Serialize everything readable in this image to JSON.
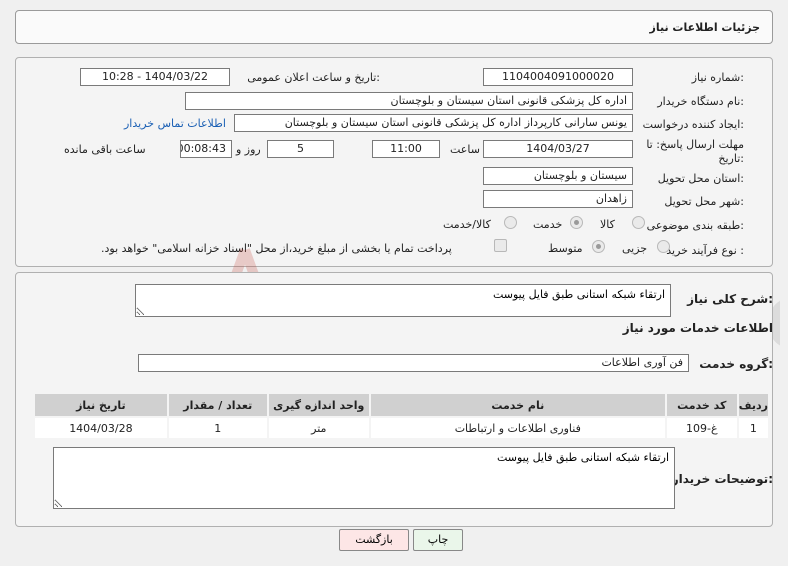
{
  "header": {
    "title": "جزئیات اطلاعات نیاز"
  },
  "info": {
    "need_number_label": "شماره نیاز:",
    "need_number": "1104004091000020",
    "announce_label": "تاریخ و ساعت اعلان عمومی:",
    "announce_value": "1404/03/22 - 10:28",
    "buyer_org_label": "نام دستگاه خریدار:",
    "buyer_org": "اداره کل پزشکی قانونی استان سیستان و بلوچستان",
    "requester_label": "ایجاد کننده درخواست:",
    "requester": "یونس سارانی کارپرداز اداره کل پزشکی قانونی استان سیستان و بلوچستان",
    "contact_link": "اطلاعات تماس خریدار",
    "deadline_label_1": "مهلت ارسال پاسخ: تا",
    "deadline_label_2": "تاریخ:",
    "deadline_date": "1404/03/27",
    "time_label": "ساعت",
    "deadline_time": "11:00",
    "days_value": "5",
    "days_label": "روز و",
    "remaining_value": "00:08:43",
    "remaining_label": "ساعت باقی مانده",
    "province_label": "استان محل تحویل:",
    "province": "سیستان و بلوچستان",
    "city_label": "شهر محل تحویل:",
    "city": "زاهدان",
    "category_label": "طبقه بندی موضوعی:",
    "category_options": [
      "کالا",
      "خدمت",
      "کالا/خدمت"
    ],
    "category_selected": 1,
    "process_label": "نوع فرآیند خرید :",
    "process_options": [
      "جزیی",
      "متوسط"
    ],
    "process_selected": 1,
    "payment_note": "پرداخت تمام یا بخشی از مبلغ خرید،از محل \"اسناد خزانه اسلامی\" خواهد بود."
  },
  "details": {
    "summary_label": "شرح کلی نیاز:",
    "summary_value": "ارتقاء شبکه استانی طبق فایل پیوست",
    "services_heading": "اطلاعات خدمات مورد نیاز",
    "service_group_label": "گروه خدمت:",
    "service_group": "فن آوری اطلاعات",
    "table": {
      "headers": [
        "ردیف",
        "کد خدمت",
        "نام خدمت",
        "واحد اندازه گیری",
        "تعداد / مقدار",
        "تاریخ نیاز"
      ],
      "rows": [
        [
          "1",
          "غ-109",
          "فناوری اطلاعات و ارتباطات",
          "متر",
          "1",
          "1404/03/28"
        ]
      ]
    },
    "buyer_notes_label": "توضیحات خریدار:",
    "buyer_notes": "ارتقاء شبکه استانی طبق فایل پیوست"
  },
  "actions": {
    "print_label": "چاپ",
    "back_label": "بازگشت"
  },
  "watermark": {
    "text": "AriaTender.neT"
  },
  "colors": {
    "link": "#1a5fb4",
    "watermark": "#c0392b",
    "print_bg": "#eaf6ea",
    "back_bg": "#fde6e6"
  }
}
